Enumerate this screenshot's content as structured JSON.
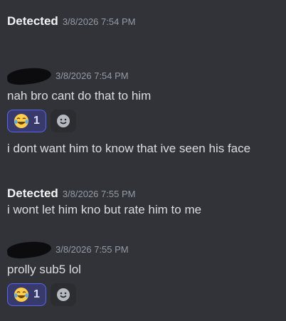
{
  "messages": [
    {
      "author": "Detected",
      "timestamp": "3/8/2026 7:54 PM",
      "lines": [
        ""
      ]
    },
    {
      "author": "",
      "timestamp": "3/8/2026 7:54 PM",
      "lines": [
        "nah bro cant do that to him",
        "i dont want him to know that ive seen his face"
      ],
      "reaction": {
        "emoji": "laughing-crying-emoji",
        "count": "1"
      }
    },
    {
      "author": "Detected",
      "timestamp": "3/8/2026 7:55 PM",
      "lines": [
        "i wont let him kno but rate him to me"
      ]
    },
    {
      "author": "",
      "timestamp": "3/8/2026 7:55 PM",
      "lines": [
        "prolly sub5 lol"
      ],
      "reaction": {
        "emoji": "laughing-crying-emoji",
        "count": "1"
      }
    }
  ],
  "colors": {
    "background": "#313338",
    "reaction_bg": "#373a6b",
    "reaction_border": "#5865f2",
    "author": "#f2f3f5",
    "timestamp": "#949ba4"
  }
}
